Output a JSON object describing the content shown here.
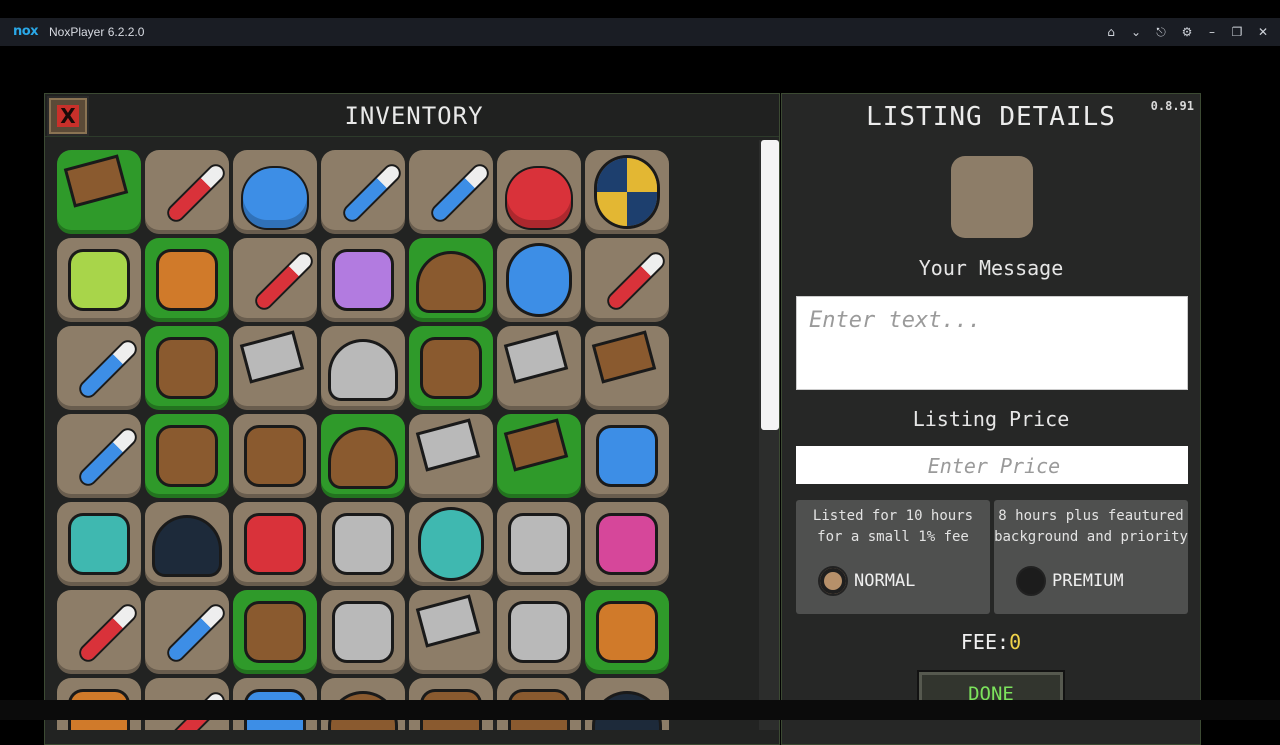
{
  "emulator": {
    "logo": "nox",
    "title": "NoxPlayer 6.2.2.0",
    "controls": [
      "home-icon",
      "chevron-down-icon",
      "pin-icon",
      "gear-icon",
      "minimize-icon",
      "restore-icon",
      "close-icon"
    ]
  },
  "inventory": {
    "title": "INVENTORY",
    "close_label": "X",
    "items": [
      "hammer",
      "red-potion-vial",
      "blue-flask",
      "blue-potion-vial",
      "blue-potion-vial",
      "red-potion-flask",
      "round-shield",
      "green-scroll",
      "leather-glove",
      "red-potion-vial",
      "purple-scroll",
      "wizard-hat",
      "blue-shield",
      "red-potion-vial",
      "blue-potion-vial",
      "green-cloak",
      "stone-hammer",
      "skull-helmet",
      "bow",
      "battle-axe",
      "wooden-mallet",
      "blue-potion-vial",
      "bow",
      "leather-boots",
      "leather-helmet",
      "steel-hammer",
      "club",
      "blue-leggings",
      "teal-gauntlet",
      "dark-hood",
      "red-chest-armor",
      "steel-blade",
      "teal-shield",
      "chain-amulet",
      "pink-sash",
      "red-potion-vial",
      "blue-potion-vial",
      "fur-boots",
      "steel-gauntlet",
      "iron-hammer",
      "steel-glove",
      "leather-glove",
      "orange-armor",
      "red-potion-vial",
      "blue-gem",
      "leather-cap",
      "brown-bag",
      "leather-vest",
      "dark-helmet"
    ]
  },
  "listing": {
    "title": "LISTING DETAILS",
    "version": "0.8.91",
    "message_label": "Your Message",
    "message_placeholder": "Enter text...",
    "price_label": "Listing Price",
    "price_placeholder": "Enter Price",
    "options": [
      {
        "desc_line1": "Listed for 10 hours",
        "desc_line2": "for a small 1% fee",
        "name": "NORMAL",
        "selected": true
      },
      {
        "desc_line1": "8 hours plus feautured",
        "desc_line2": "background and priority",
        "name": "PREMIUM",
        "selected": false
      }
    ],
    "fee_label": "FEE:",
    "fee_value": "0",
    "done_label": "DONE"
  },
  "colors": {
    "panel": "#222322",
    "slot": "#8d7d68",
    "slot_green": "#2f9a2a",
    "fee_value": "#f0d34a",
    "done_text": "#7ce35c"
  }
}
